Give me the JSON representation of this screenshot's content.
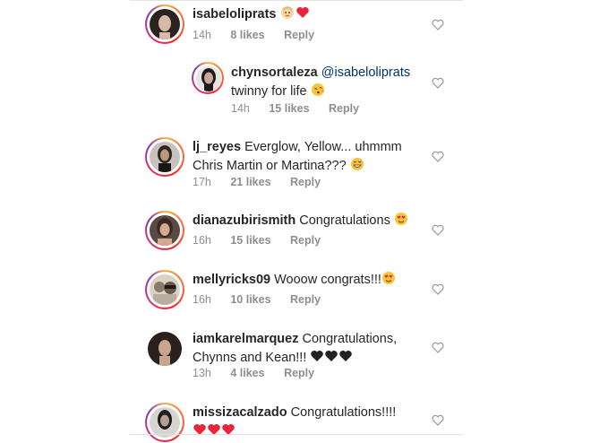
{
  "comments": [
    {
      "username": "isabeloliprats",
      "text": "",
      "emojis": [
        "baby-face",
        "red-heart"
      ],
      "time": "14h",
      "likes": "8 likes",
      "reply": "Reply",
      "avatar_ring": true,
      "avatar_colors": [
        "#2a2320",
        "#d7b9a6"
      ]
    },
    {
      "username": "chynsortaleza",
      "mention": "@isabeloliprats",
      "line2": "twinny for life",
      "emojis": [
        "kissing-face"
      ],
      "time": "14h",
      "likes": "15 likes",
      "reply": "Reply",
      "avatar_ring": true,
      "avatar_colors": [
        "#1d1a1a",
        "#c9a898"
      ]
    },
    {
      "username": "lj_reyes",
      "text": "Everglow, Yellow... uhmmm",
      "line2": "Chris Martin or Martina???",
      "emojis": [
        "grinning-sweat-face"
      ],
      "time": "17h",
      "likes": "21 likes",
      "reply": "Reply",
      "avatar_ring": true,
      "avatar_colors": [
        "#2b2622",
        "#b99880"
      ]
    },
    {
      "username": "dianazubirismith",
      "text": "Congratulations",
      "emojis": [
        "heart-eyes-face"
      ],
      "time": "16h",
      "likes": "15 likes",
      "reply": "Reply",
      "avatar_ring": true,
      "avatar_colors": [
        "#3a2a24",
        "#d6a890"
      ]
    },
    {
      "username": "mellyricks09",
      "text": "Wooow congrats!!!",
      "emojis": [
        "heart-eyes-face"
      ],
      "time": "16h",
      "likes": "10 likes",
      "reply": "Reply",
      "avatar_ring": true,
      "avatar_colors": [
        "#8a7a6a",
        "#dcd2c4"
      ]
    },
    {
      "username": "iamkarelmarquez",
      "text": "Congratulations,",
      "line2": "Chynns and Kean!!!",
      "emojis": [
        "black-heart",
        "black-heart",
        "black-heart"
      ],
      "time": "13h",
      "likes": "4 likes",
      "reply": "Reply",
      "avatar_ring": false,
      "avatar_colors": [
        "#2a201c",
        "#c9a590"
      ]
    },
    {
      "username": "missizacalzado",
      "text": "Congratulations!!!!",
      "emojis": [
        "red-heart",
        "red-heart",
        "red-heart"
      ],
      "time": "",
      "likes": "",
      "reply": "",
      "avatar_ring": true,
      "avatar_colors": [
        "#1f1c1c",
        "#b8a090"
      ]
    }
  ],
  "icons": {
    "like": "heart-outline-icon"
  }
}
